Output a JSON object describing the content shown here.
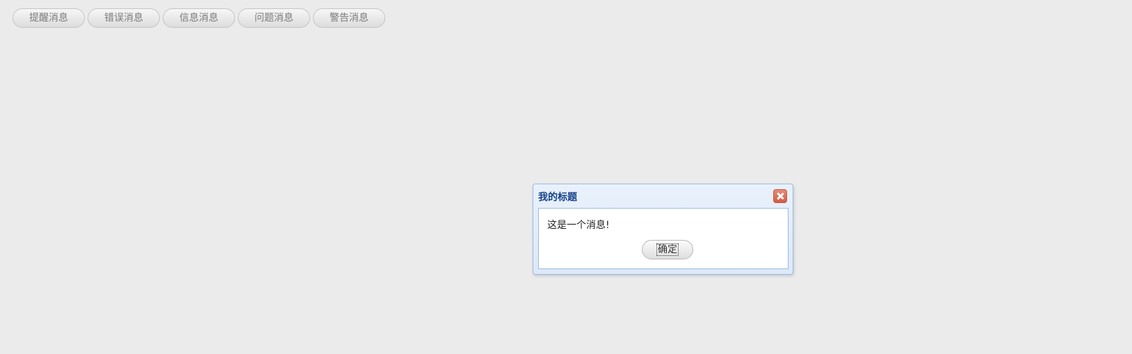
{
  "toolbar": {
    "buttons": [
      {
        "label": "提醒消息"
      },
      {
        "label": "错误消息"
      },
      {
        "label": "信息消息"
      },
      {
        "label": "问题消息"
      },
      {
        "label": "警告消息"
      }
    ]
  },
  "dialog": {
    "title": "我的标题",
    "message": "这是一个消息!",
    "ok_label": "确定",
    "close_icon": "close-icon"
  }
}
